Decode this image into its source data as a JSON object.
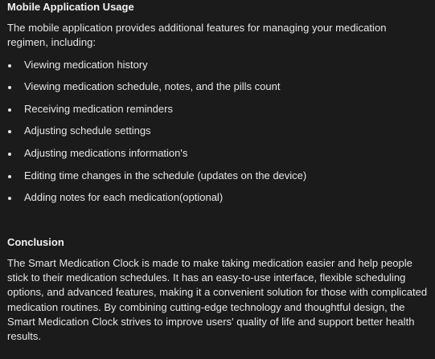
{
  "sections": {
    "usage": {
      "heading": "Mobile Application Usage",
      "intro": "The mobile application provides additional features for managing your medication regimen, including:",
      "features": [
        "Viewing medication history",
        "Viewing medication schedule, notes, and the pills count",
        "Receiving medication reminders",
        "Adjusting schedule settings",
        "Adjusting medications information's",
        "Editing time changes in the schedule (updates on the device)",
        "Adding notes for each medication(optional)"
      ]
    },
    "conclusion": {
      "heading": "Conclusion",
      "body": "The Smart Medication Clock is made to make taking medication easier and help people stick to their medication schedules. It has an easy-to-use interface, flexible scheduling options, and advanced features, making it a convenient solution for those with complicated medication routines. By combining cutting-edge technology and thoughtful design, the Smart Medication Clock strives to improve users' quality of life and support better health results."
    }
  }
}
